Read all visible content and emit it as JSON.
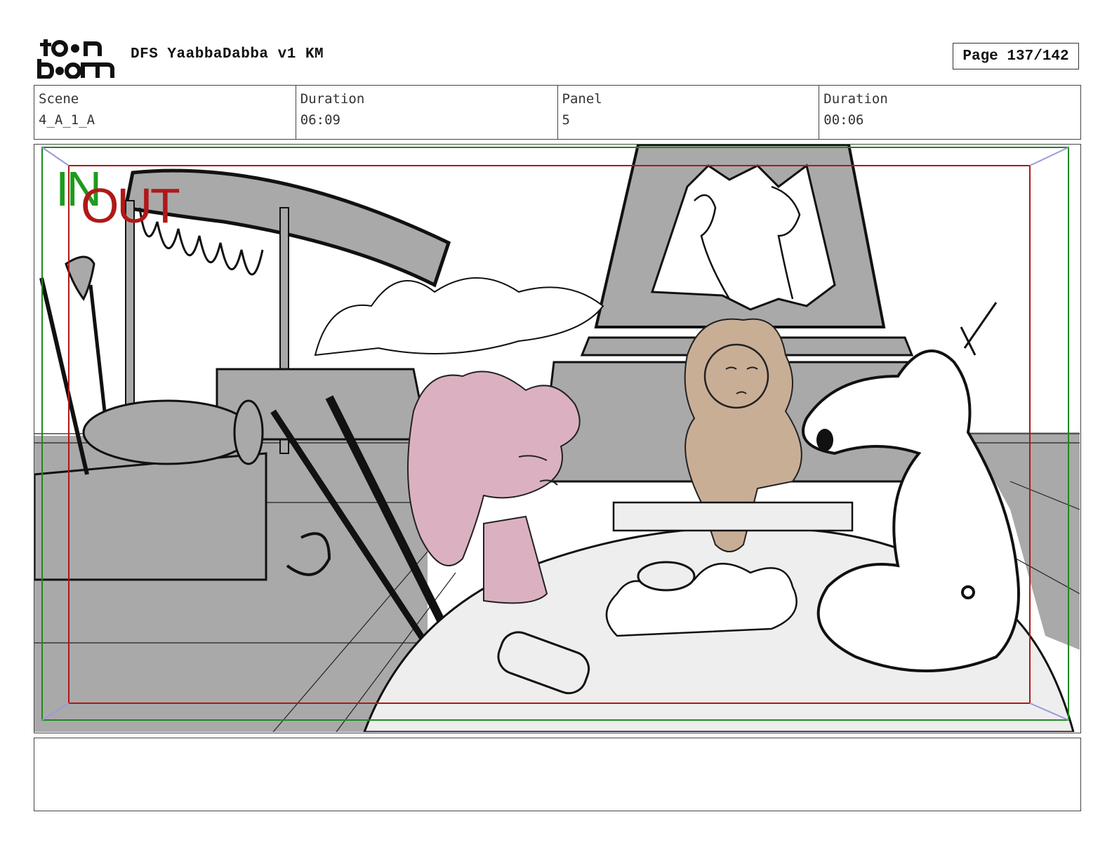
{
  "header": {
    "logo_text": "toon boom",
    "project_title": "DFS YaabbaDabba v1 KM",
    "page_counter": "Page 137/142"
  },
  "info": {
    "scene_label": "Scene",
    "scene_value": "4_A_1_A",
    "scene_duration_label": "Duration",
    "scene_duration_value": "06:09",
    "panel_label": "Panel",
    "panel_value": "5",
    "panel_duration_label": "Duration",
    "panel_duration_value": "00:06"
  },
  "panel": {
    "in_marker": "IN",
    "out_marker": "OUT",
    "colors": {
      "in_frame": "#1e8a1e",
      "out_frame": "#b01818",
      "gray_fill": "#a9a9a9",
      "pink_character": "#dbb1c2",
      "tan_character": "#c9ae96",
      "corner_arrows": "#9a9ad8"
    }
  },
  "notes": {
    "text": ""
  }
}
